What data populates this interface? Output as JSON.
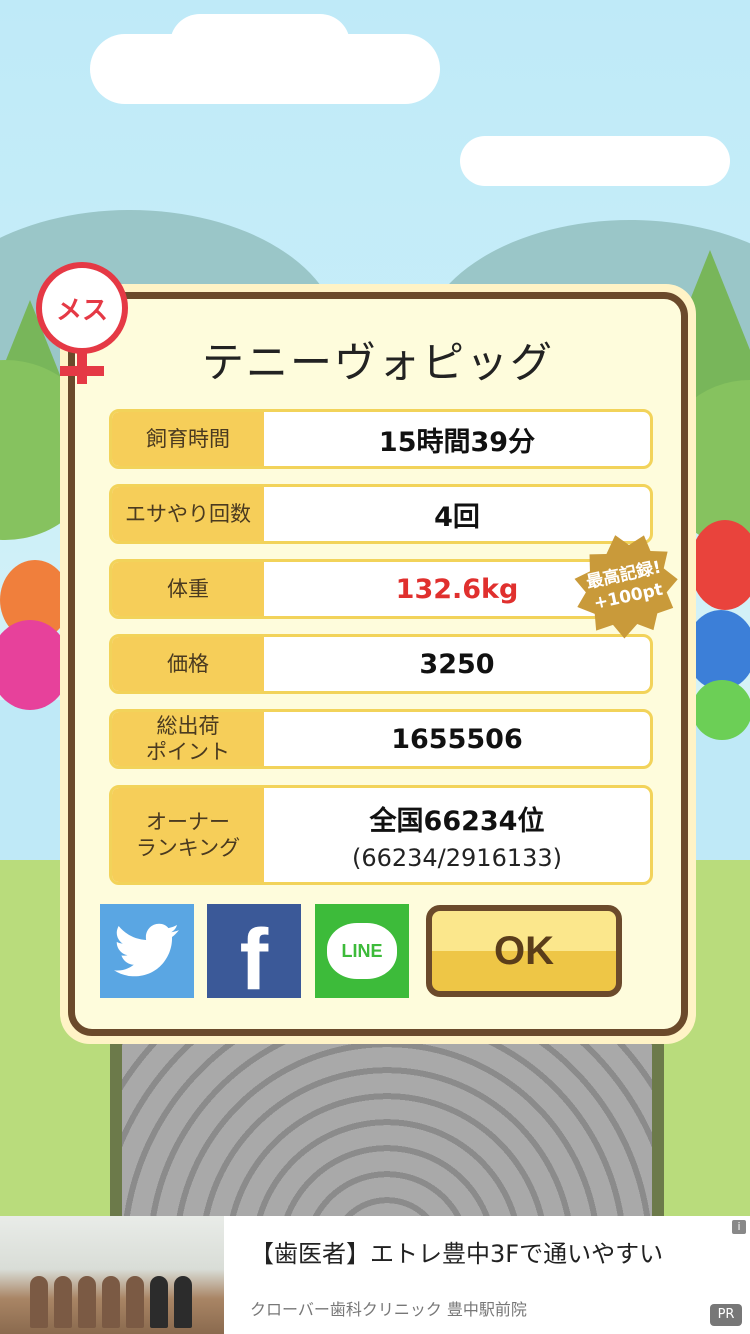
{
  "badge": {
    "label": "メス"
  },
  "pig_name": "テニーヴォピッグ",
  "stats": [
    {
      "label_line1": "飼育時間",
      "label_line2": "",
      "value": "15時間39分",
      "sub": ""
    },
    {
      "label_line1": "エサやり回数",
      "label_line2": "",
      "value": "4回",
      "sub": ""
    },
    {
      "label_line1": "体重",
      "label_line2": "",
      "value": "132.6kg",
      "sub": ""
    },
    {
      "label_line1": "価格",
      "label_line2": "",
      "value": "3250",
      "sub": ""
    },
    {
      "label_line1": "総出荷",
      "label_line2": "ポイント",
      "value": "1655506",
      "sub": ""
    },
    {
      "label_line1": "オーナー",
      "label_line2": "ランキング",
      "value": "全国66234位",
      "sub": "(66234/2916133)"
    }
  ],
  "record_badge": {
    "line1": "最高記録!",
    "line2": "+100pt"
  },
  "buttons": {
    "ok": "OK",
    "line": "LINE",
    "facebook": "f"
  },
  "ad": {
    "title": "【歯医者】エトレ豊中3Fで通いやすい",
    "subtitle": "クローバー歯科クリニック 豊中駅前院",
    "info": "i",
    "pr": "PR"
  },
  "colors": {
    "weight_value": "#e0302e",
    "dialog_border": "#6b4a2b",
    "label_bg": "#f6ce59"
  }
}
